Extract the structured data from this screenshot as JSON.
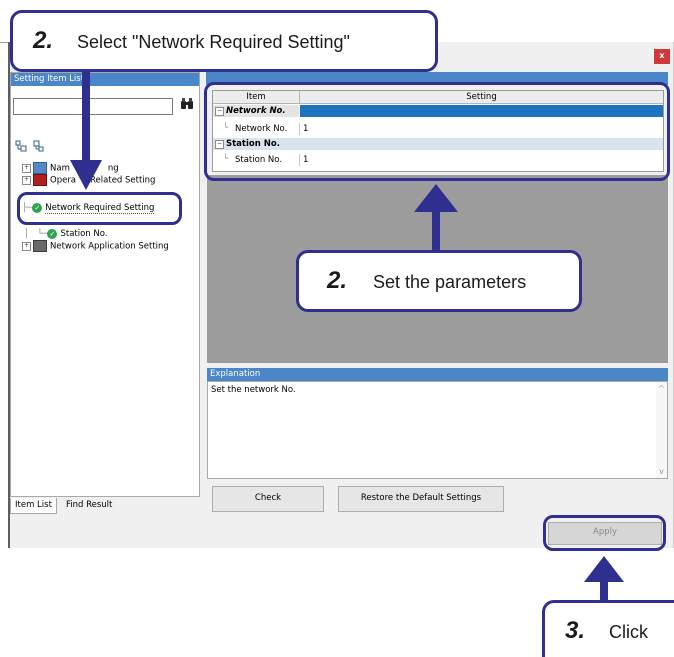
{
  "window": {
    "close_icon": "x"
  },
  "left_pane": {
    "title": "Setting Item List",
    "search_value": "",
    "tree": [
      {
        "label": "Nam",
        "label2": "ng",
        "icon": "list-icon",
        "expander": "+"
      },
      {
        "label": "Opera",
        "label2": "Related Setting",
        "icon": "book-icon",
        "expander": "+"
      },
      {
        "label": "Network Required Setting",
        "icon": "check-icon"
      },
      {
        "label": "Station No.",
        "icon": "check-icon"
      },
      {
        "label": "Network Application Setting",
        "icon": "network-icon",
        "expander": "+"
      }
    ],
    "tabs": [
      "Item List",
      "Find Result"
    ]
  },
  "grid": {
    "columns": [
      "Item",
      "Setting"
    ],
    "rows": [
      {
        "label": "Network No.",
        "value": "",
        "type": "group",
        "expander": "−"
      },
      {
        "label": "Network No.",
        "value": "1",
        "type": "item"
      },
      {
        "label": "Station No.",
        "value": "",
        "type": "group",
        "expander": "−"
      },
      {
        "label": "Station No.",
        "value": "1",
        "type": "item"
      }
    ]
  },
  "explanation": {
    "title": "Explanation",
    "text": "Set the network No.",
    "scroll_up": "^",
    "scroll_down": "v"
  },
  "buttons": {
    "check": "Check",
    "restore": "Restore the Default Settings",
    "apply": "Apply"
  },
  "callouts": {
    "c1_num": "2.",
    "c1_text": "Select \"Network Required Setting\"",
    "c2_num": "2.",
    "c2_text": "Set the parameters",
    "c3_num": "3.",
    "c3_text": "Click"
  },
  "colors": {
    "callout_border": "#2f2f8f",
    "header_blue": "#4a86c8",
    "selected_row": "#1e73be"
  }
}
